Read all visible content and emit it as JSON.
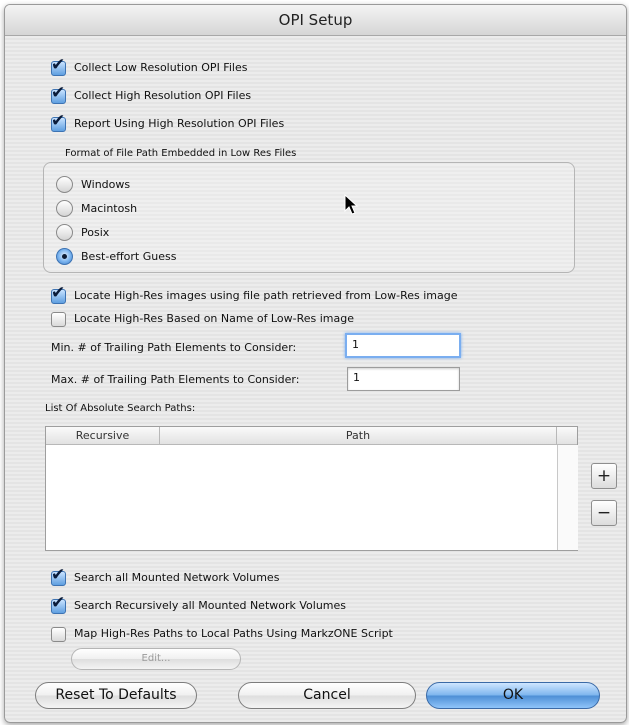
{
  "window": {
    "title": "OPI Setup"
  },
  "collect": [
    {
      "label": "Collect Low Resolution OPI Files",
      "checked": true
    },
    {
      "label": "Collect High Resolution OPI Files",
      "checked": true
    },
    {
      "label": "Report Using High Resolution OPI Files",
      "checked": true
    }
  ],
  "format_group": {
    "title": "Format of File Path Embedded in Low Res Files",
    "options": [
      {
        "label": "Windows",
        "selected": false
      },
      {
        "label": "Macintosh",
        "selected": false
      },
      {
        "label": "Posix",
        "selected": false
      },
      {
        "label": "Best-effort Guess",
        "selected": true
      }
    ]
  },
  "locate": [
    {
      "label": "Locate High-Res images using file path retrieved from Low-Res image",
      "checked": true
    },
    {
      "label": "Locate High-Res Based on Name of Low-Res image",
      "checked": false
    }
  ],
  "trailing": {
    "min_label": "Min. # of Trailing Path Elements to Consider:",
    "min_value": "1",
    "max_label": "Max. # of Trailing Path Elements to Consider:",
    "max_value": "1"
  },
  "search_paths": {
    "title": "List Of Absolute Search Paths:",
    "columns": [
      "Recursive",
      "Path"
    ],
    "rows": [],
    "add_label": "+",
    "remove_label": "−"
  },
  "network": [
    {
      "label": "Search all Mounted Network Volumes",
      "checked": true
    },
    {
      "label": "Search Recursively all Mounted Network Volumes",
      "checked": true
    },
    {
      "label": "Map High-Res Paths to Local Paths Using MarkzONE Script",
      "checked": false
    }
  ],
  "edit_button": {
    "label": "Edit..."
  },
  "buttons": {
    "reset": "Reset To Defaults",
    "cancel": "Cancel",
    "ok": "OK"
  }
}
